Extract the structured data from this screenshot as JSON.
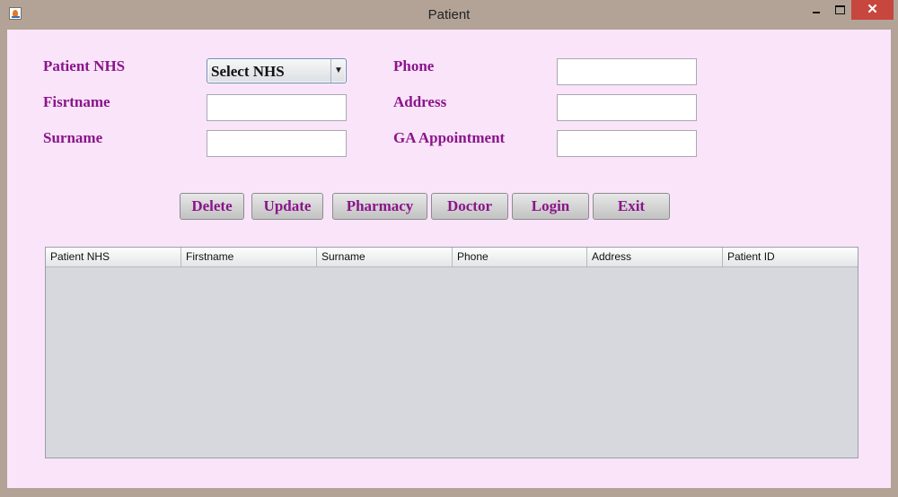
{
  "window": {
    "title": "Patient",
    "close_label": "✕",
    "icons": {
      "app": "java-app-icon",
      "minimize": "minimize-icon",
      "maximize": "maximize-icon",
      "close": "close-icon"
    }
  },
  "form": {
    "labels": {
      "patient_nhs": "Patient NHS",
      "firstname": "Fisrtname",
      "surname": "Surname",
      "phone": "Phone",
      "address": "Address",
      "ga_appointment": "GA Appointment"
    },
    "patient_nhs_select": {
      "selected": "Select NHS"
    },
    "values": {
      "firstname": "",
      "surname": "",
      "phone": "",
      "address": "",
      "ga_appointment": ""
    }
  },
  "buttons": {
    "delete": "Delete",
    "update": "Update",
    "pharmacy": "Pharmacy",
    "doctor": "Doctor",
    "login": "Login",
    "exit": "Exit"
  },
  "table": {
    "columns": [
      "Patient NHS",
      "Firstname",
      "Surname",
      "Phone",
      "Address",
      "Patient ID"
    ],
    "rows": []
  },
  "colors": {
    "background": "#f9e4f9",
    "label_text": "#8b148b",
    "frame": "#b3a397",
    "close_button": "#c7463e"
  }
}
